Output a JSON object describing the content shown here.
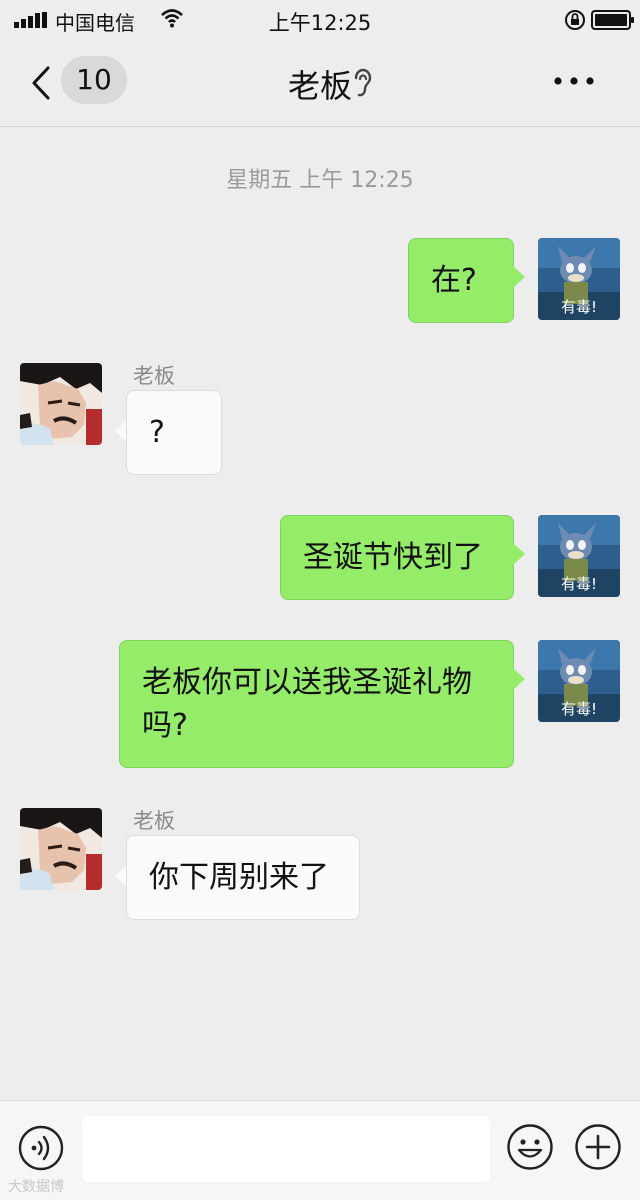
{
  "status_bar": {
    "carrier": "中国电信",
    "time": "上午12:25"
  },
  "nav": {
    "unread_count": "10",
    "title": "老板"
  },
  "timestamp": "星期五 上午 12:25",
  "messages": [
    {
      "from": "me",
      "text": "在?",
      "avatar_caption": "有毒!"
    },
    {
      "from": "them",
      "sender": "老板",
      "text": "?"
    },
    {
      "from": "me",
      "text": "圣诞节快到了",
      "avatar_caption": "有毒!"
    },
    {
      "from": "me",
      "text": "老板你可以送我圣诞礼物吗?",
      "avatar_caption": "有毒!"
    },
    {
      "from": "them",
      "sender": "老板",
      "text": "你下周别来了"
    }
  ],
  "input_bar": {
    "icons": [
      "voice-icon",
      "emoji-icon",
      "plus-icon"
    ]
  },
  "watermark": "大数据博",
  "colors": {
    "background": "#ededed",
    "my_bubble": "#95ec69",
    "their_bubble": "#fafafa"
  }
}
